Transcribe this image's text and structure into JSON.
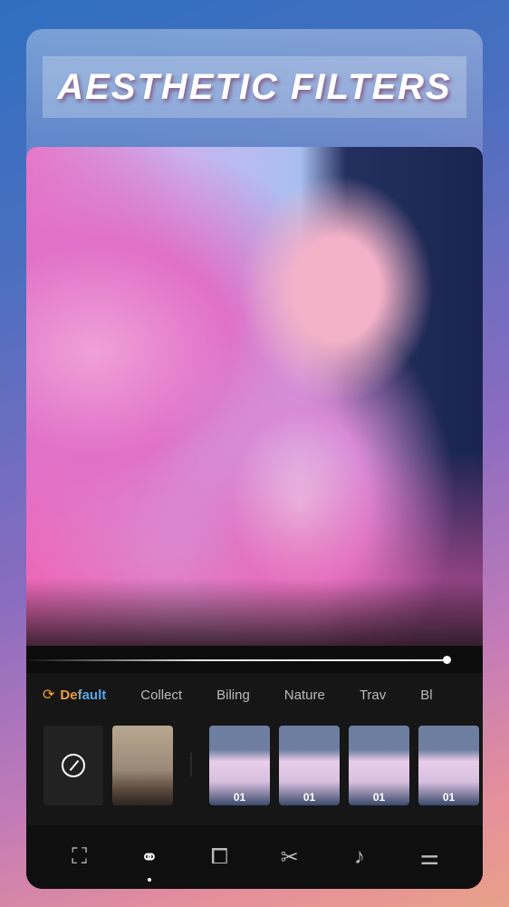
{
  "banner": {
    "title": "AESTHETIC FILTERS"
  },
  "filters": {
    "tabs": [
      "Default",
      "Collect",
      "Biling",
      "Nature",
      "Trav",
      "Bl"
    ],
    "thumbnail_labels": [
      "01",
      "01",
      "01",
      "01"
    ]
  },
  "nav": {
    "items": [
      "magic-enhance-icon",
      "filter-icon",
      "crop-icon",
      "scissors-icon",
      "music-note-icon",
      "adjust-sliders-icon"
    ],
    "active": "filter-icon"
  },
  "playback": {
    "progress": 0.92
  }
}
